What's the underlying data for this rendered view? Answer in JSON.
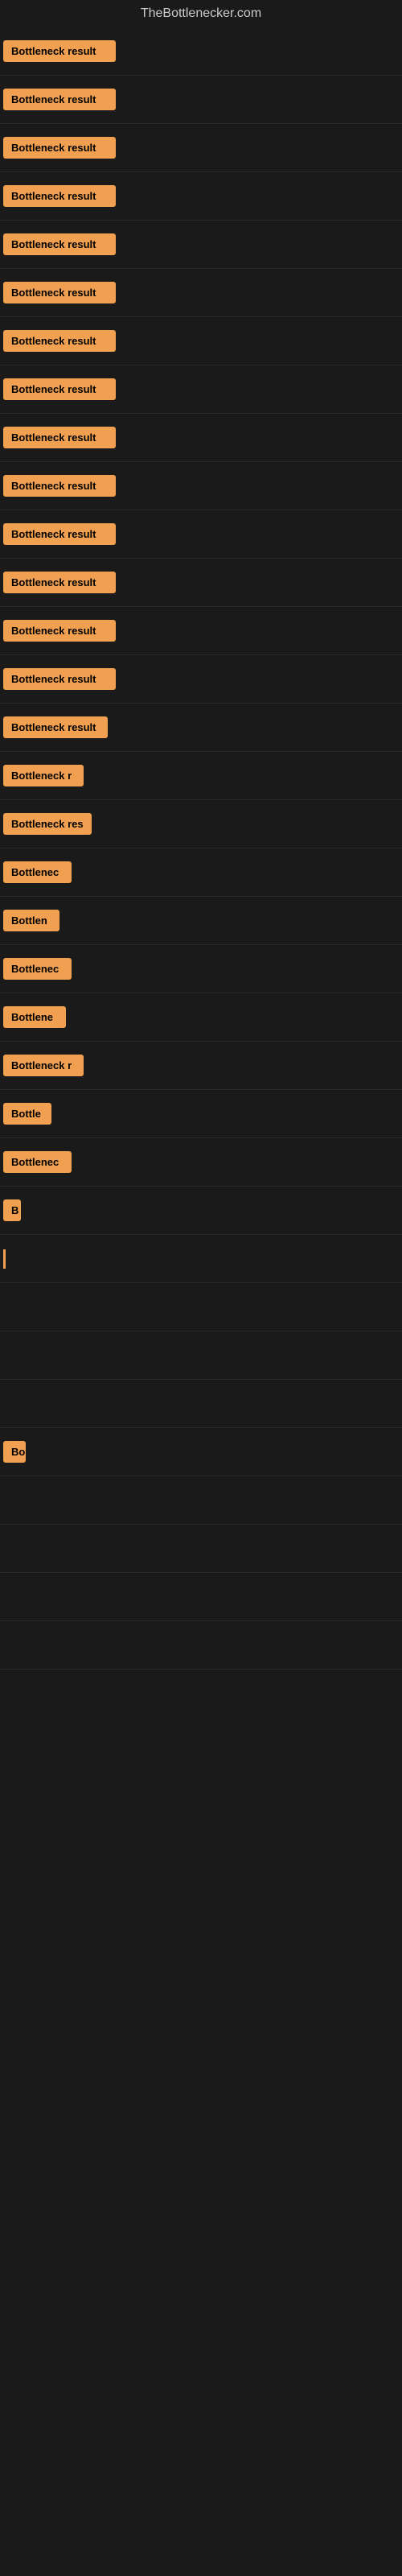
{
  "site": {
    "title": "TheBottlenecker.com"
  },
  "items": [
    {
      "label": "Bottleneck result",
      "width": 140
    },
    {
      "label": "Bottleneck result",
      "width": 140
    },
    {
      "label": "Bottleneck result",
      "width": 140
    },
    {
      "label": "Bottleneck result",
      "width": 140
    },
    {
      "label": "Bottleneck result",
      "width": 140
    },
    {
      "label": "Bottleneck result",
      "width": 140
    },
    {
      "label": "Bottleneck result",
      "width": 140
    },
    {
      "label": "Bottleneck result",
      "width": 140
    },
    {
      "label": "Bottleneck result",
      "width": 140
    },
    {
      "label": "Bottleneck result",
      "width": 140
    },
    {
      "label": "Bottleneck result",
      "width": 140
    },
    {
      "label": "Bottleneck result",
      "width": 140
    },
    {
      "label": "Bottleneck result",
      "width": 140
    },
    {
      "label": "Bottleneck result",
      "width": 140
    },
    {
      "label": "Bottleneck result",
      "width": 130
    },
    {
      "label": "Bottleneck r",
      "width": 100
    },
    {
      "label": "Bottleneck res",
      "width": 110
    },
    {
      "label": "Bottlenec",
      "width": 85
    },
    {
      "label": "Bottlen",
      "width": 70
    },
    {
      "label": "Bottlenec",
      "width": 85
    },
    {
      "label": "Bottlene",
      "width": 78
    },
    {
      "label": "Bottleneck r",
      "width": 100
    },
    {
      "label": "Bottle",
      "width": 60
    },
    {
      "label": "Bottlenec",
      "width": 85
    },
    {
      "label": "B",
      "width": 22
    },
    {
      "label": "|",
      "width": 12
    },
    {
      "label": "",
      "width": 0
    },
    {
      "label": "",
      "width": 0
    },
    {
      "label": "",
      "width": 0
    },
    {
      "label": "Bo",
      "width": 28
    },
    {
      "label": "",
      "width": 0
    },
    {
      "label": "",
      "width": 0
    },
    {
      "label": "",
      "width": 0
    },
    {
      "label": "",
      "width": 0
    }
  ]
}
